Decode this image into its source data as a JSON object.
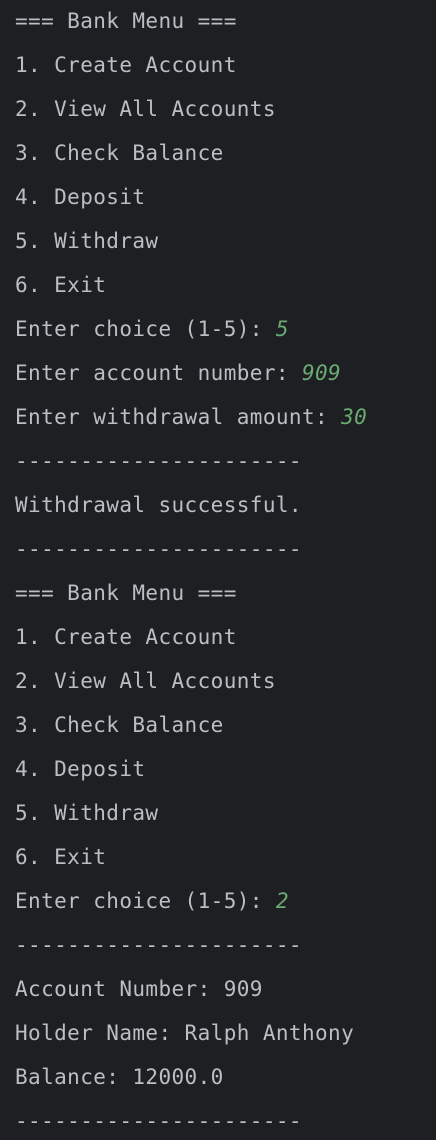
{
  "console": {
    "lines": [
      {
        "text": "=== Bank Menu ===",
        "input": ""
      },
      {
        "text": "1. Create Account",
        "input": ""
      },
      {
        "text": "2. View All Accounts",
        "input": ""
      },
      {
        "text": "3. Check Balance",
        "input": ""
      },
      {
        "text": "4. Deposit",
        "input": ""
      },
      {
        "text": "5. Withdraw",
        "input": ""
      },
      {
        "text": "6. Exit",
        "input": ""
      },
      {
        "text": "Enter choice (1-5): ",
        "input": "5"
      },
      {
        "text": "Enter account number: ",
        "input": "909"
      },
      {
        "text": "Enter withdrawal amount: ",
        "input": "30"
      },
      {
        "text": "----------------------",
        "input": ""
      },
      {
        "text": "Withdrawal successful.",
        "input": ""
      },
      {
        "text": "----------------------",
        "input": ""
      },
      {
        "text": "=== Bank Menu ===",
        "input": ""
      },
      {
        "text": "1. Create Account",
        "input": ""
      },
      {
        "text": "2. View All Accounts",
        "input": ""
      },
      {
        "text": "3. Check Balance",
        "input": ""
      },
      {
        "text": "4. Deposit",
        "input": ""
      },
      {
        "text": "5. Withdraw",
        "input": ""
      },
      {
        "text": "6. Exit",
        "input": ""
      },
      {
        "text": "Enter choice (1-5): ",
        "input": "2"
      },
      {
        "text": "----------------------",
        "input": ""
      },
      {
        "text": "Account Number: 909",
        "input": ""
      },
      {
        "text": "Holder Name: Ralph Anthony",
        "input": ""
      },
      {
        "text": "Balance: 12000.0",
        "input": ""
      },
      {
        "text": "----------------------",
        "input": ""
      }
    ]
  },
  "colors": {
    "background": "#1e1f22",
    "output_text": "#bcbec4",
    "user_input": "#6aab73"
  }
}
